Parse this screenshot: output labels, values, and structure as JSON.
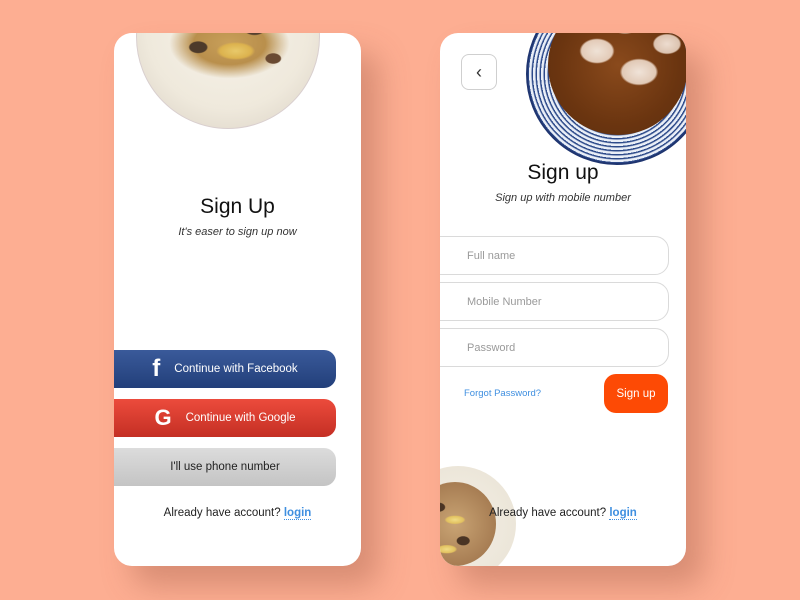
{
  "colors": {
    "background": "#fdae92",
    "facebook": "#2c4a87",
    "google": "#d83a2e",
    "phone": "#d0d0d0",
    "link": "#3f8fe0",
    "signup_accent": "#fd4a05"
  },
  "screen1": {
    "title": "Sign Up",
    "subtitle": "It's easer to sign up now",
    "buttons": [
      {
        "icon": "facebook-icon",
        "glyph": "f",
        "label": "Continue with Facebook"
      },
      {
        "icon": "google-icon",
        "glyph": "G",
        "label": "Continue with Google"
      },
      {
        "label": "I'll use phone number"
      }
    ],
    "footer_text": "Already have account?",
    "footer_link": "login"
  },
  "screen2": {
    "back_icon": "chevron-left-icon",
    "back_glyph": "‹",
    "title": "Sign up",
    "subtitle": "Sign up with mobile number",
    "fields": [
      {
        "placeholder": "Full name",
        "value": ""
      },
      {
        "placeholder": "Mobile Number",
        "value": ""
      },
      {
        "placeholder": "Password",
        "value": ""
      }
    ],
    "forgot_link": "Forgot Password?",
    "submit_label": "Sign up",
    "footer_text": "Already have account?",
    "footer_link": "login"
  }
}
